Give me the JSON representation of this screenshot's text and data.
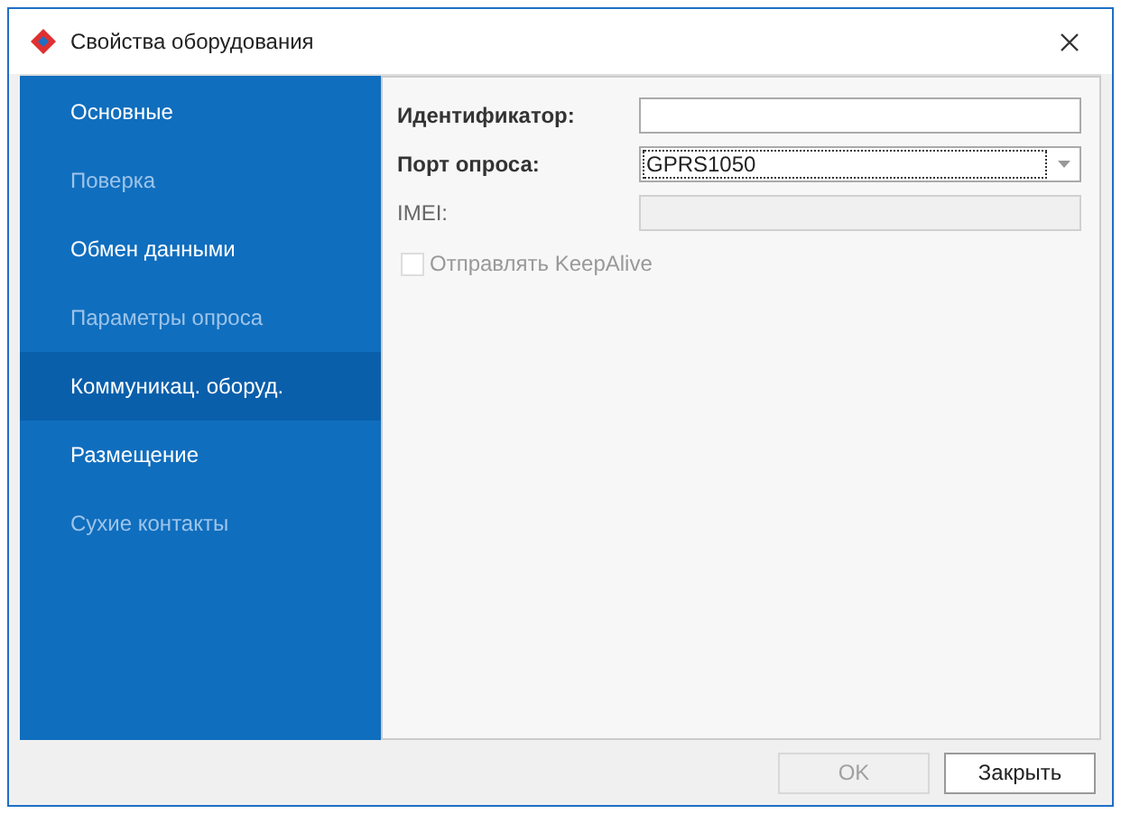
{
  "window": {
    "title": "Свойства оборудования"
  },
  "sidebar": {
    "items": [
      {
        "label": "Основные",
        "disabled": false,
        "selected": false
      },
      {
        "label": "Поверка",
        "disabled": true,
        "selected": false
      },
      {
        "label": "Обмен данными",
        "disabled": false,
        "selected": false
      },
      {
        "label": "Параметры опроса",
        "disabled": true,
        "selected": false
      },
      {
        "label": "Коммуникац. оборуд.",
        "disabled": false,
        "selected": true
      },
      {
        "label": "Размещение",
        "disabled": false,
        "selected": false
      },
      {
        "label": "Сухие контакты",
        "disabled": true,
        "selected": false
      }
    ]
  },
  "form": {
    "fields": [
      {
        "kind": "text",
        "label": "Идентификатор:",
        "disabled": false
      },
      {
        "kind": "dropdown",
        "label": "Порт опроса:",
        "value": "GPRS1050",
        "disabled": false
      },
      {
        "kind": "text",
        "label": "IMEI:",
        "disabled": true
      }
    ],
    "checkbox": {
      "label": "Отправлять KeepAlive",
      "checked": false,
      "disabled": true
    }
  },
  "buttons": [
    {
      "label": "OK",
      "disabled": true
    },
    {
      "label": "Закрыть",
      "disabled": false
    }
  ]
}
